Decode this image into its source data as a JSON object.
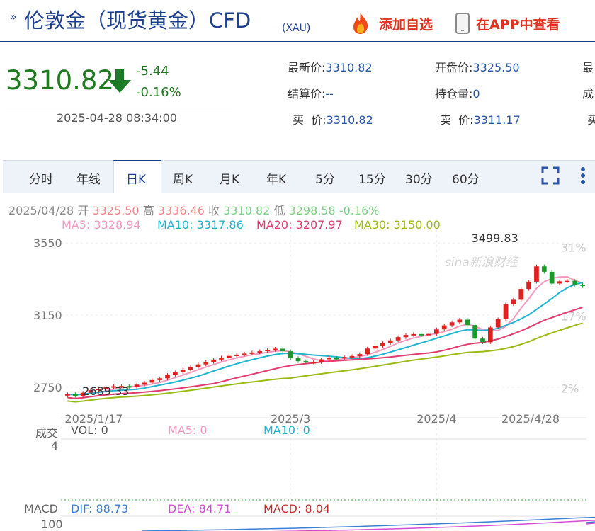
{
  "header": {
    "title": "伦敦金（现货黄金）CFD",
    "subtitle": "(XAU)",
    "add_watch": "添加自选",
    "app_view": "在APP中查看"
  },
  "quote": {
    "price": "3310.82",
    "change": "-5.44",
    "change_pct": "-0.16%",
    "time": "2025-04-28 08:34:00",
    "fields": [
      {
        "label": "最新价:",
        "value": "3310.82"
      },
      {
        "label": "开盘价:",
        "value": "3325.50"
      },
      {
        "label": "最",
        "value": ""
      },
      {
        "label": "结算价:",
        "value": "--"
      },
      {
        "label": "持仓量:",
        "value": "0"
      },
      {
        "label": "成",
        "value": ""
      },
      {
        "label": "买  价:",
        "value": "3310.82"
      },
      {
        "label": "卖  价:",
        "value": "3311.17"
      },
      {
        "label": "买",
        "value": ""
      }
    ]
  },
  "tabs": [
    "分时",
    "年线",
    "日K",
    "周K",
    "月K",
    "年K",
    "5分",
    "15分",
    "30分",
    "60分"
  ],
  "active_tab": "日K",
  "colors": {
    "up": "#e0201f",
    "down": "#1a9a2a",
    "ma5": "#f49ac1",
    "ma10": "#1fb4d0",
    "ma20": "#e23c6e",
    "ma30": "#9bbb14",
    "brand": "#1c3f8f"
  },
  "chart_data": {
    "type": "candlestick",
    "info": {
      "date": "2025/04/28",
      "open_label": "开",
      "open": "3325.50",
      "high_label": "高",
      "high": "3336.46",
      "close_label": "收",
      "close": "3310.82",
      "low_label": "低",
      "low": "3298.58",
      "pct": "-0.16%"
    },
    "ma_legend": [
      {
        "name": "MA5",
        "text": "MA5: 3328.94"
      },
      {
        "name": "MA10",
        "text": "MA10: 3317.86"
      },
      {
        "name": "MA20",
        "text": "MA20: 3207.97"
      },
      {
        "name": "MA30",
        "text": "MA30: 3150.00"
      }
    ],
    "y_ticks": [
      "3550",
      "3150",
      "2750"
    ],
    "y_tick_values": [
      3550,
      3150,
      2750
    ],
    "ylim": [
      2660,
      3570
    ],
    "pct_ticks": [
      "31%",
      "17%",
      "2%"
    ],
    "pct_tick_values": [
      3525,
      3145,
      2745
    ],
    "x_ticks": [
      "2025/1/17",
      "2025/3",
      "2025/4",
      "2025/4/28"
    ],
    "x_tick_index": [
      0,
      29,
      48,
      64
    ],
    "max_label": "3499.83",
    "max_index": 59,
    "min_label": "2689.33",
    "min_index": 1,
    "closes": [
      2712,
      2703,
      2720,
      2734,
      2742,
      2750,
      2756,
      2757,
      2753,
      2765,
      2776,
      2790,
      2800,
      2818,
      2833,
      2848,
      2863,
      2877,
      2891,
      2904,
      2915,
      2924,
      2931,
      2937,
      2943,
      2950,
      2958,
      2964,
      2950,
      2912,
      2895,
      2888,
      2890,
      2905,
      2913,
      2912,
      2918,
      2923,
      2934,
      2965,
      2980,
      2995,
      3010,
      3028,
      3040,
      3045,
      3040,
      3046,
      3071,
      3093,
      3110,
      3125,
      3095,
      3020,
      3000,
      3082,
      3127,
      3210,
      3235,
      3295,
      3335,
      3420,
      3390,
      3325,
      3337,
      3340,
      3319,
      3311
    ],
    "volume": {
      "label": "成交",
      "vol": "VOL: 0",
      "ma5": "MA5: 0",
      "ma10": "MA10: 0",
      "y_tick": "4"
    },
    "macd": {
      "label": "MACD",
      "dif": "DIF: 88.73",
      "dea": "DEA: 84.71",
      "macd": "MACD: 8.04",
      "y_tick": "100"
    }
  },
  "watermark": "新浪财经"
}
